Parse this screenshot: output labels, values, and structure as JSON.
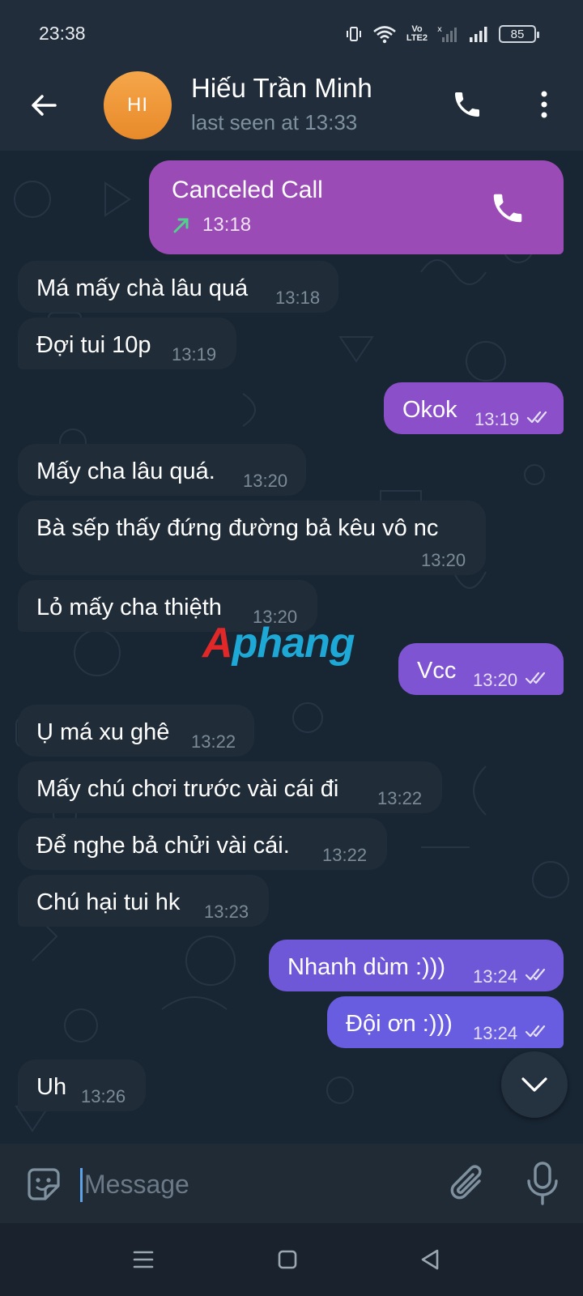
{
  "status_bar": {
    "time": "23:38",
    "vo_lte_top": "Vo",
    "vo_lte_bottom": "LTE2",
    "battery": "85"
  },
  "header": {
    "avatar_initials": "HI",
    "avatar_color": "#f0993a",
    "contact_name": "Hiếu Trần Minh",
    "status": "last seen at 13:33"
  },
  "messages": {
    "call": {
      "title": "Canceled Call",
      "time": "13:18",
      "accent": "#9b4bb5"
    },
    "m1": {
      "text": "Má mấy chà lâu quá",
      "time": "13:18"
    },
    "m2": {
      "text": "Đợi tui 10p",
      "time": "13:19"
    },
    "m3": {
      "text": "Okok",
      "time": "13:19"
    },
    "m4": {
      "text": "Mấy cha lâu quá.",
      "time": "13:20"
    },
    "m5": {
      "text": "Bà sếp thấy đứng đường bả kêu vô nc",
      "time": "13:20"
    },
    "m6": {
      "text": "Lỏ mấy cha thiệth",
      "time": "13:20"
    },
    "m7": {
      "text": "Vcc",
      "time": "13:20"
    },
    "m8": {
      "text": "Ụ má xu ghê",
      "time": "13:22"
    },
    "m9": {
      "text": "Mấy chú chơi trước vài cái đi",
      "time": "13:22"
    },
    "m10": {
      "text": "Để nghe bả chửi vài cái.",
      "time": "13:22"
    },
    "m11": {
      "text": "Chú hại tui hk",
      "time": "13:23"
    },
    "m12": {
      "text": "Nhanh dùm :)))",
      "time": "13:24"
    },
    "m13": {
      "text": "Đội ơn :)))",
      "time": "13:24"
    },
    "m14": {
      "text": "Uh",
      "time": "13:26"
    }
  },
  "watermark": {
    "first": "A",
    "rest": "phang"
  },
  "composer": {
    "placeholder": "Message"
  },
  "colors": {
    "incoming_bubble": "#202c38",
    "outgoing_gradient": [
      "#b04bb0",
      "#8a52d8",
      "#6e5ce6"
    ]
  },
  "icons": {
    "back": "arrow-left-icon",
    "call": "phone-icon",
    "more": "more-vertical-icon",
    "sticker": "sticker-icon",
    "attach": "paperclip-icon",
    "mic": "microphone-icon",
    "scroll": "chevron-down-icon",
    "read": "double-check-icon"
  }
}
